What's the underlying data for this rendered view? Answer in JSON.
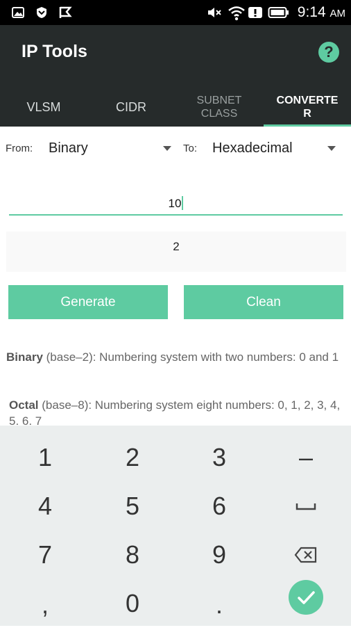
{
  "status": {
    "time": "9:14",
    "ampm": "AM"
  },
  "app": {
    "title": "IP Tools",
    "help": "?"
  },
  "tabs": [
    {
      "label": "VLSM"
    },
    {
      "label": "CIDR"
    },
    {
      "label_line1": "SUBNET",
      "label_line2": "CLASS"
    },
    {
      "label_line1": "CONVERTE",
      "label_line2": "R",
      "active": true
    }
  ],
  "converter": {
    "from_label": "From:",
    "from_value": "Binary",
    "to_label": "To:",
    "to_value": "Hexadecimal",
    "input_value": "10",
    "result_value": "2",
    "generate_label": "Generate",
    "clean_label": "Clean"
  },
  "descriptions": [
    {
      "term": "Binary",
      "text": " (base–2): Numbering system with two numbers: 0 and 1"
    },
    {
      "term": "Octal",
      "text": " (base–8): Numbering system eight numbers: 0, 1, 2, 3, 4, 5, 6, 7"
    }
  ],
  "keyboard": {
    "k1": "1",
    "k2": "2",
    "k3": "3",
    "minus": "–",
    "k4": "4",
    "k5": "5",
    "k6": "6",
    "space": "␣",
    "k7": "7",
    "k8": "8",
    "k9": "9",
    "comma": ",",
    "k0": "0",
    "period": "."
  },
  "colors": {
    "accent": "#5ecba1",
    "appbar": "#262b2b",
    "keyboard": "#ebeeee"
  }
}
